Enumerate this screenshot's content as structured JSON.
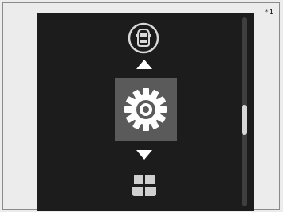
{
  "footnote": "*1",
  "menu": {
    "items": [
      {
        "name": "car-icon"
      },
      {
        "name": "gear-icon",
        "selected": true
      },
      {
        "name": "grid-icon"
      }
    ],
    "arrows": [
      "arrow-up-icon",
      "arrow-down-icon"
    ]
  },
  "scrollbar": {
    "position_fraction": 0.55,
    "thumb_fraction": 0.16
  },
  "colors": {
    "screen_bg": "#1c1c1c",
    "selected_bg": "#5a5a5a",
    "icon": "#ffffff",
    "dim_icon": "#d8d8d8"
  }
}
